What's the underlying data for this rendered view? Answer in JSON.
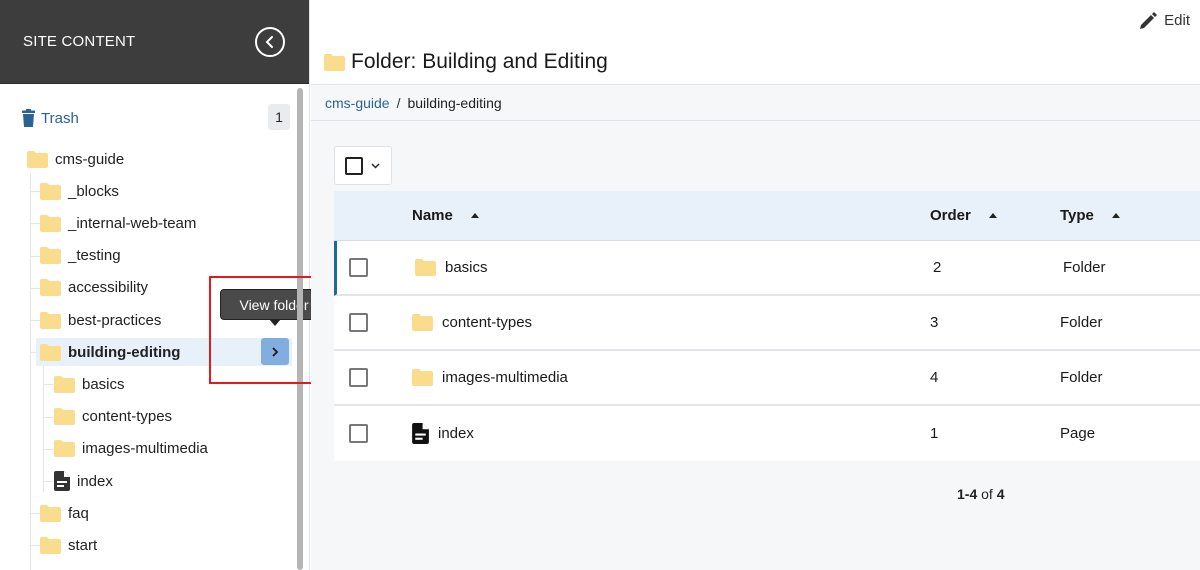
{
  "sidebar": {
    "title": "SITE CONTENT",
    "trash": {
      "label": "Trash",
      "count": "1"
    },
    "tree": [
      {
        "label": "cms-guide",
        "icon": "folder-icon",
        "level": 0
      },
      {
        "label": "_blocks",
        "icon": "folder-icon",
        "level": 1
      },
      {
        "label": "_internal-web-team",
        "icon": "folder-icon",
        "level": 1
      },
      {
        "label": "_testing",
        "icon": "folder-icon",
        "level": 1
      },
      {
        "label": "accessibility",
        "icon": "folder-icon",
        "level": 1
      },
      {
        "label": "best-practices",
        "icon": "folder-icon",
        "level": 1
      },
      {
        "label": "building-editing",
        "icon": "folder-icon",
        "level": 1,
        "active": true
      },
      {
        "label": "basics",
        "icon": "folder-icon",
        "level": 2
      },
      {
        "label": "content-types",
        "icon": "folder-icon",
        "level": 2
      },
      {
        "label": "images-multimedia",
        "icon": "folder-icon",
        "level": 2
      },
      {
        "label": "index",
        "icon": "page-icon",
        "level": 2
      },
      {
        "label": "faq",
        "icon": "folder-icon",
        "level": 1
      },
      {
        "label": "start",
        "icon": "folder-icon",
        "level": 1
      }
    ],
    "tooltip": "View folder"
  },
  "header": {
    "edit_label": "Edit",
    "title": "Folder: Building and Editing"
  },
  "breadcrumb": {
    "root": "cms-guide",
    "separator": "/",
    "current": "building-editing"
  },
  "table": {
    "columns": {
      "name": "Name",
      "order": "Order",
      "type": "Type"
    },
    "rows": [
      {
        "name": "basics",
        "icon": "folder-icon",
        "order": "2",
        "type": "Folder"
      },
      {
        "name": "content-types",
        "icon": "folder-icon",
        "order": "3",
        "type": "Folder"
      },
      {
        "name": "images-multimedia",
        "icon": "folder-icon",
        "order": "4",
        "type": "Folder"
      },
      {
        "name": "index",
        "icon": "page-icon",
        "order": "1",
        "type": "Page"
      }
    ]
  },
  "pagination": {
    "range": "1-4",
    "of": "of",
    "total": "4"
  },
  "colors": {
    "folder": "#f9dc8c",
    "link": "#2b6394",
    "header_bg": "#3d3d3d",
    "active_bg": "#e8f0f9",
    "accent": "#1b6b94"
  }
}
